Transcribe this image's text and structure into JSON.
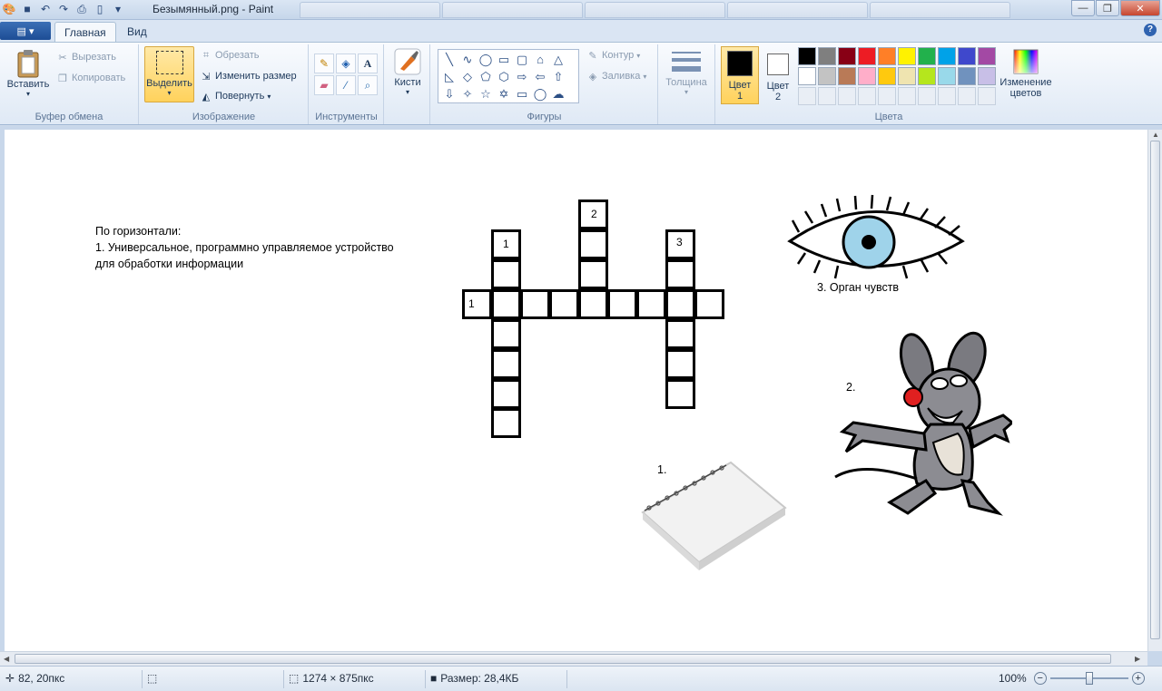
{
  "window": {
    "title": "Безымянный.png - Paint",
    "controls": [
      "minimize",
      "maximize",
      "close"
    ]
  },
  "tabs": [
    {
      "label": "Главная",
      "active": true
    },
    {
      "label": "Вид",
      "active": false
    }
  ],
  "ribbon": {
    "clipboard": {
      "paste": "Вставить",
      "cut": "Вырезать",
      "copy": "Копировать",
      "group": "Буфер обмена"
    },
    "image": {
      "select": "Выделить",
      "crop": "Обрезать",
      "resize": "Изменить размер",
      "rotate": "Повернуть",
      "group": "Изображение"
    },
    "tools": {
      "group": "Инструменты"
    },
    "brushes": {
      "label": "Кисти"
    },
    "shapes": {
      "outline": "Контур",
      "fill": "Заливка",
      "group": "Фигуры"
    },
    "size": {
      "label": "Толщина"
    },
    "colors": {
      "color1_line1": "Цвет",
      "color1_line2": "1",
      "color2_line1": "Цвет",
      "color2_line2": "2",
      "edit_line1": "Изменение",
      "edit_line2": "цветов",
      "group": "Цвета",
      "color1_value": "#000000",
      "color2_value": "#ffffff",
      "palette": [
        "#000000",
        "#7f7f7f",
        "#880015",
        "#ed1c24",
        "#ff7f27",
        "#fff200",
        "#22b14c",
        "#00a2e8",
        "#3f48cc",
        "#a349a4",
        "#ffffff",
        "#c3c3c3",
        "#b97a57",
        "#ffaec9",
        "#ffc90e",
        "#efe4b0",
        "#b5e61d",
        "#99d9ea",
        "#7092be",
        "#c8bfe7"
      ]
    }
  },
  "canvas": {
    "clue_heading": "По горизонтали:",
    "clue_line1": "1. Универсальное, программно управляемое устройство",
    "clue_line2": "для обработки информации",
    "cell_numbers": {
      "h1": "1",
      "v1": "1",
      "v2": "2",
      "v3": "3"
    },
    "label_eye": "3. Орган чувств",
    "label_mouse": "2.",
    "label_notebook": "1."
  },
  "status": {
    "cursor_pos": "82, 20пкс",
    "image_size": "1274 × 875пкс",
    "file_size": "Размер: 28,4КБ",
    "zoom": "100%",
    "zoom_level": 0.5
  }
}
